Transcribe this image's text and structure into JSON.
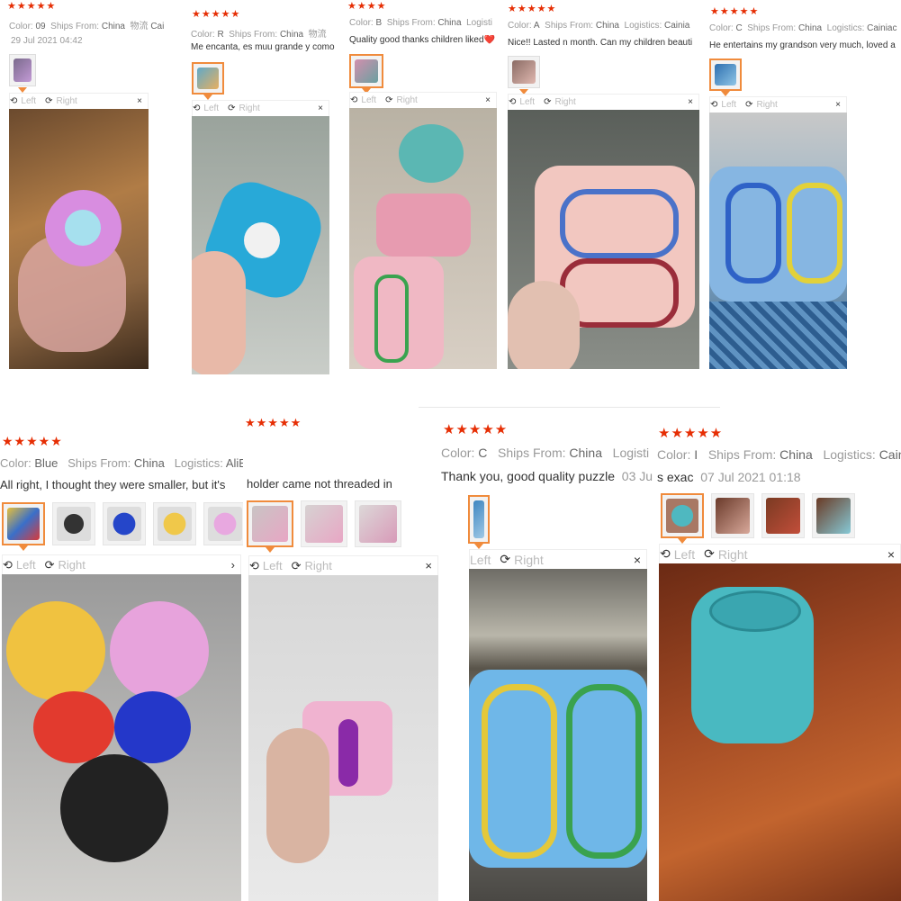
{
  "reviews": [
    {
      "stars": "★★★★★",
      "color_label": "Color:",
      "color_value": "09",
      "ships_label": "Ships From:",
      "ships_value": "China",
      "logistics_label": "物流",
      "logistics_value": "Cai",
      "text": "",
      "date": "29 Jul 2021 04:42"
    },
    {
      "stars": "★★★★★",
      "color_label": "Color:",
      "color_value": "R",
      "ships_label": "Ships From:",
      "ships_value": "China",
      "logistics_label": "物流",
      "logistics_value": "",
      "text": "Me encanta, es muu grande y como",
      "date": ""
    },
    {
      "stars": "★★★★",
      "color_label": "Color:",
      "color_value": "B",
      "ships_label": "Ships From:",
      "ships_value": "China",
      "logistics_label": "Logisti",
      "logistics_value": "",
      "text": "Quality good thanks children liked❤️",
      "date": ""
    },
    {
      "stars": "★★★★★",
      "color_label": "Color:",
      "color_value": "A",
      "ships_label": "Ships From:",
      "ships_value": "China",
      "logistics_label": "Logistics:",
      "logistics_value": "Cainia",
      "text": "Nice!! Lasted n month. Can my children beauti",
      "date": ""
    },
    {
      "stars": "★★★★★",
      "color_label": "Color:",
      "color_value": "C",
      "ships_label": "Ships From:",
      "ships_value": "China",
      "logistics_label": "Logistics:",
      "logistics_value": "Cainiac",
      "text": "He entertains my grandson very much, loved a",
      "date": ""
    },
    {
      "stars": "★★★★★",
      "color_label": "Color:",
      "color_value": "Blue",
      "ships_label": "Ships From:",
      "ships_value": "China",
      "logistics_label": "Logistics:",
      "logistics_value": "AliExpress Saver Shipping",
      "text": "All right, I thought they were smaller, but it's",
      "date": ""
    },
    {
      "stars": "★★★★★",
      "color_label": "",
      "color_value": "",
      "ships_label": "",
      "ships_value": "",
      "logistics_label": "",
      "logistics_value": "",
      "text": "holder came not threaded in",
      "date": ""
    },
    {
      "stars": "★★★★★",
      "color_label": "Color:",
      "color_value": "C",
      "ships_label": "Ships From:",
      "ships_value": "China",
      "logistics_label": "Logisti",
      "logistics_value": "",
      "text": "Thank you, good quality puzzle",
      "date": "03 Ju"
    },
    {
      "stars": "★★★★★",
      "color_label": "Color:",
      "color_value": "I",
      "ships_label": "Ships From:",
      "ships_value": "China",
      "logistics_label": "Logistics:",
      "logistics_value": "Cainiao",
      "text": "s exac",
      "date": "07 Jul 2021 01:18"
    }
  ],
  "viewer": {
    "left_label": "Left",
    "right_label": "Right",
    "close_glyph": "×",
    "rotate_left_glyph": "⟲",
    "rotate_right_glyph": "⟳",
    "next_glyph": "›"
  },
  "icons": {
    "rotate_left": "rotate-left-icon",
    "rotate_right": "rotate-right-icon",
    "close": "close-icon"
  },
  "colors": {
    "star": "#e62e04",
    "selected_border": "#f08b3c"
  }
}
